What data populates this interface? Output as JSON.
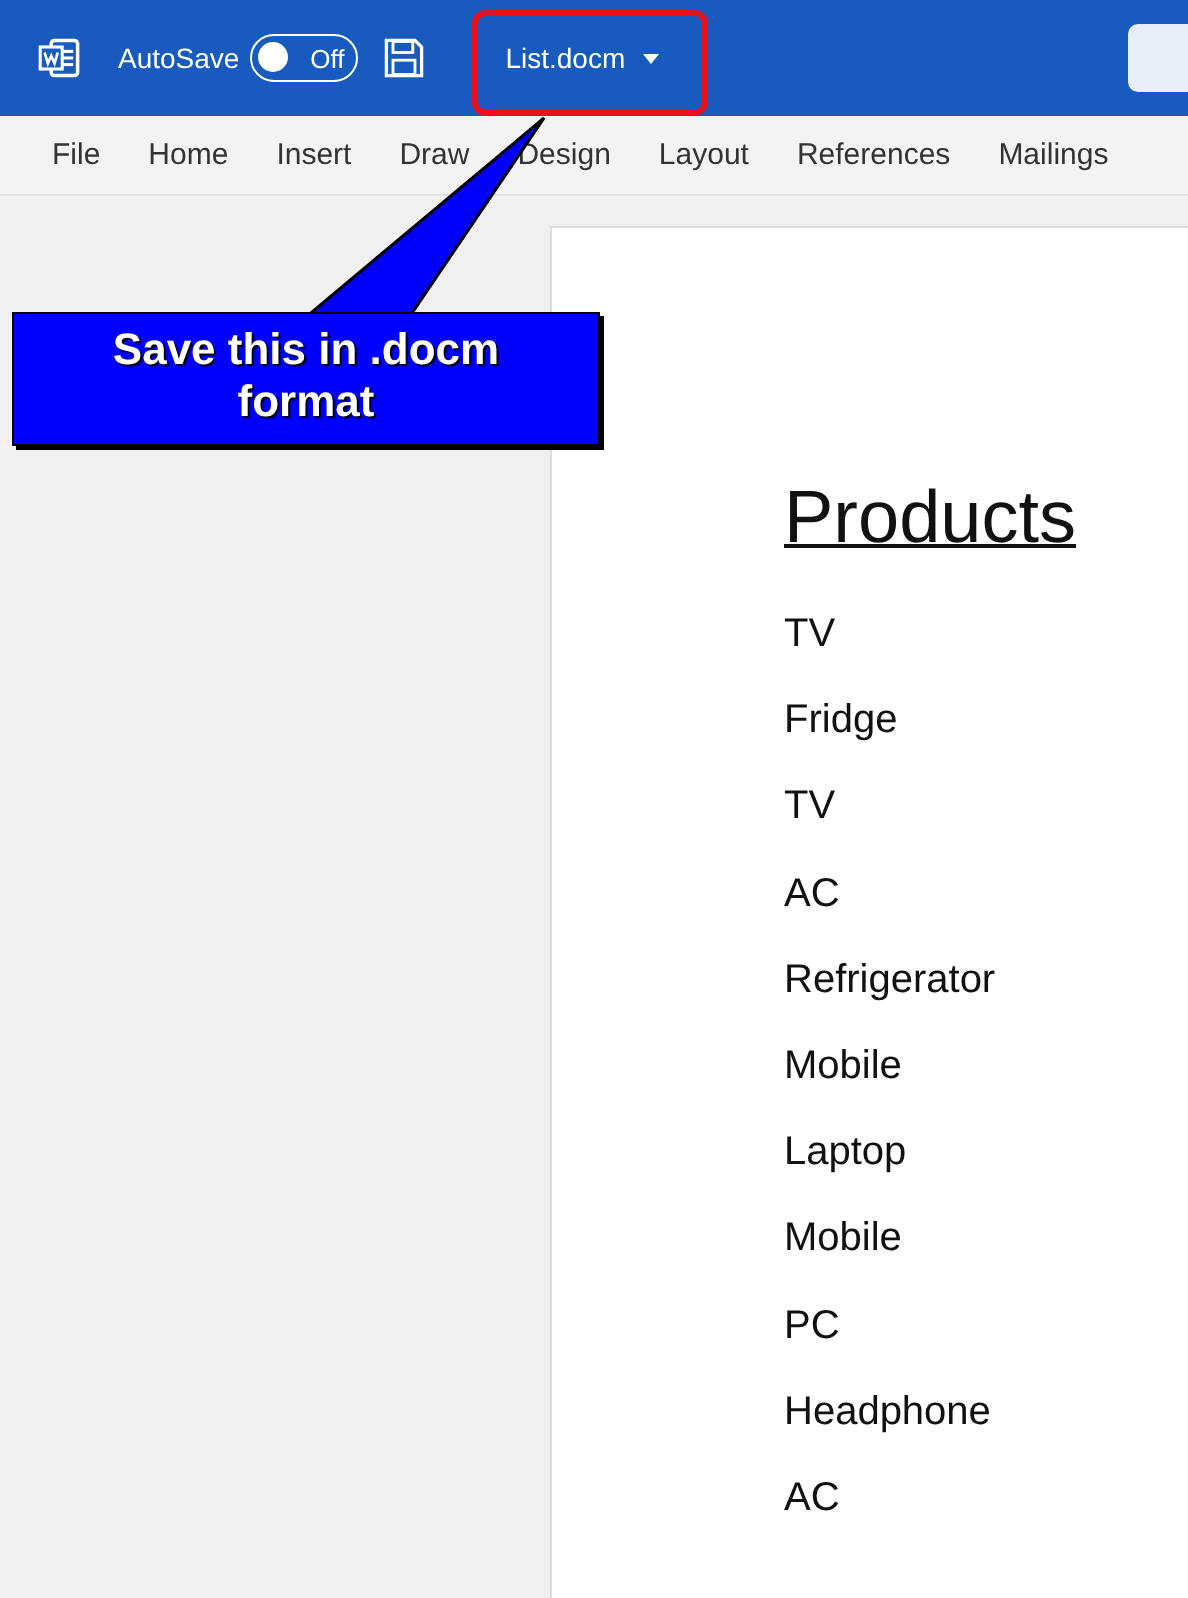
{
  "title_bar": {
    "autosave": {
      "label": "AutoSave",
      "on": false,
      "state_label": "Off"
    },
    "file_name": "List.docm",
    "file_name_highlighted": true
  },
  "ribbon_tabs": [
    {
      "label": "File",
      "selected": false
    },
    {
      "label": "Home",
      "selected": false
    },
    {
      "label": "Insert",
      "selected": false
    },
    {
      "label": "Draw",
      "selected": false
    },
    {
      "label": "Design",
      "selected": false
    },
    {
      "label": "Layout",
      "selected": false
    },
    {
      "label": "References",
      "selected": false
    },
    {
      "label": "Mailings",
      "selected": false
    }
  ],
  "callout": {
    "text": "Save this in .docm format"
  },
  "document": {
    "heading": "Products",
    "items": [
      "TV",
      "Fridge",
      "TV",
      "AC",
      "Refrigerator",
      "Mobile",
      "Laptop",
      "Mobile",
      "PC",
      "Headphone",
      "AC"
    ]
  }
}
